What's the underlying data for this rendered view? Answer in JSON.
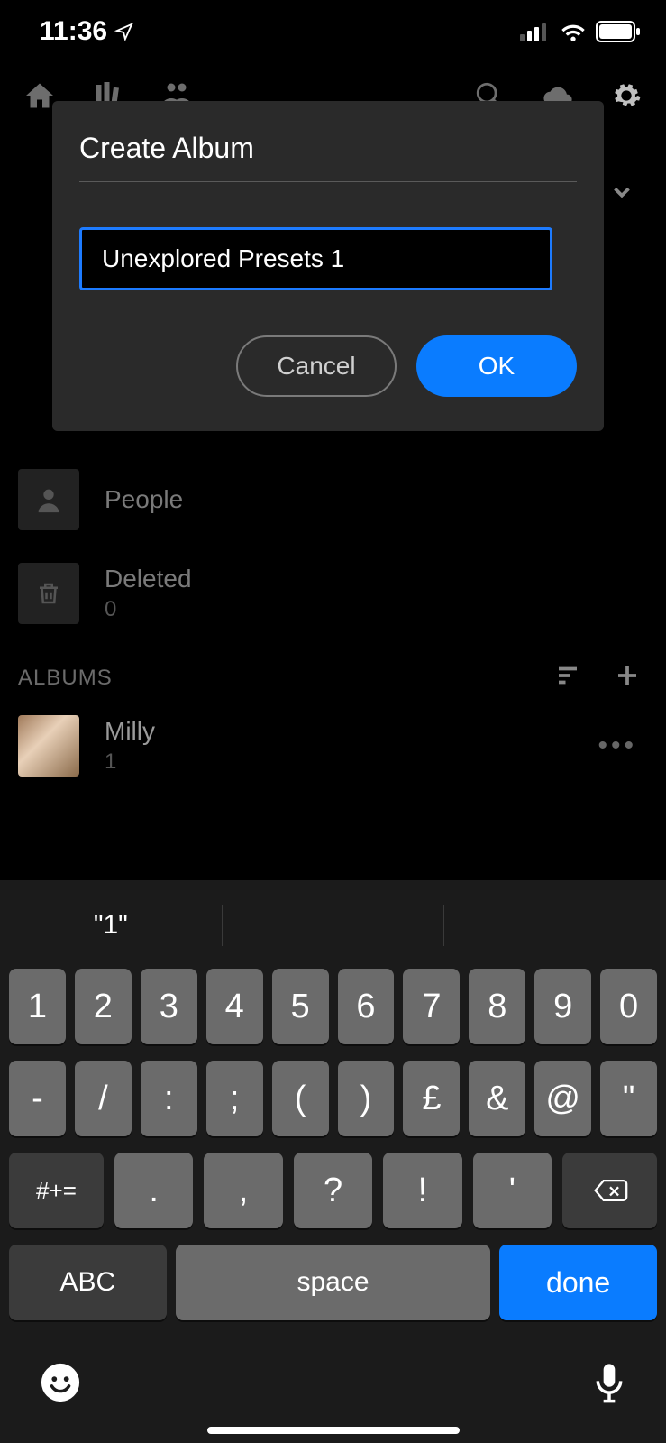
{
  "status": {
    "time": "11:36"
  },
  "modal": {
    "title": "Create Album",
    "input_value": "Unexplored Presets 1",
    "cancel_label": "Cancel",
    "ok_label": "OK"
  },
  "library": {
    "people_label": "People",
    "deleted_label": "Deleted",
    "deleted_count": "0",
    "albums_header": "ALBUMS",
    "album_name": "Milly",
    "album_count": "1"
  },
  "keyboard": {
    "suggestion": "\"1\"",
    "row1": [
      "1",
      "2",
      "3",
      "4",
      "5",
      "6",
      "7",
      "8",
      "9",
      "0"
    ],
    "row2": [
      "-",
      "/",
      ":",
      ";",
      "(",
      ")",
      "£",
      "&",
      "@",
      "\""
    ],
    "sym_key": "#+=",
    "row3": [
      ".",
      ",",
      "?",
      "!",
      "'"
    ],
    "abc_label": "ABC",
    "space_label": "space",
    "done_label": "done"
  }
}
